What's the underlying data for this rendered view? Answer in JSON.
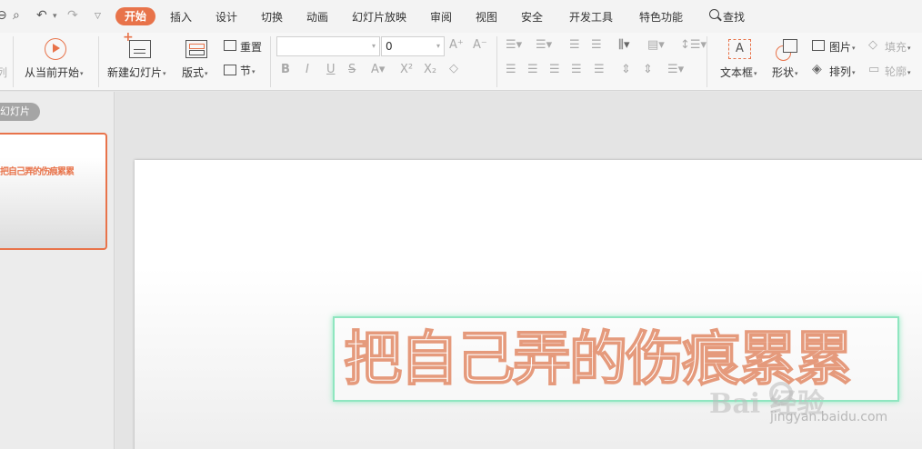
{
  "menu": {
    "tabs": [
      "开始",
      "插入",
      "设计",
      "切换",
      "动画",
      "幻灯片放映",
      "审阅",
      "视图",
      "安全",
      "开发工具",
      "特色功能"
    ],
    "active_tab": "开始",
    "search": "查找"
  },
  "ribbon": {
    "start_from_current": "从当前开始",
    "new_slide": "新建幻灯片",
    "layout": "版式",
    "reset": "重置",
    "section": "节",
    "font_size": "0",
    "text_box": "文本框",
    "shape": "形状",
    "picture": "图片",
    "arrange": "排列",
    "fill": "填充",
    "outline": "轮廓"
  },
  "left_panel": {
    "tab_label": "幻灯片",
    "thumbnail_text": "把自己弄的伤痕累累"
  },
  "slide": {
    "title_text": "把自己弄的伤痕累累"
  },
  "watermark": {
    "logo": "Bai 经验",
    "url": "jingyan.baidu.com"
  },
  "colors": {
    "accent": "#e8734a",
    "selection_glow": "#8fe6c0",
    "text_outline": "#e59a7c"
  }
}
